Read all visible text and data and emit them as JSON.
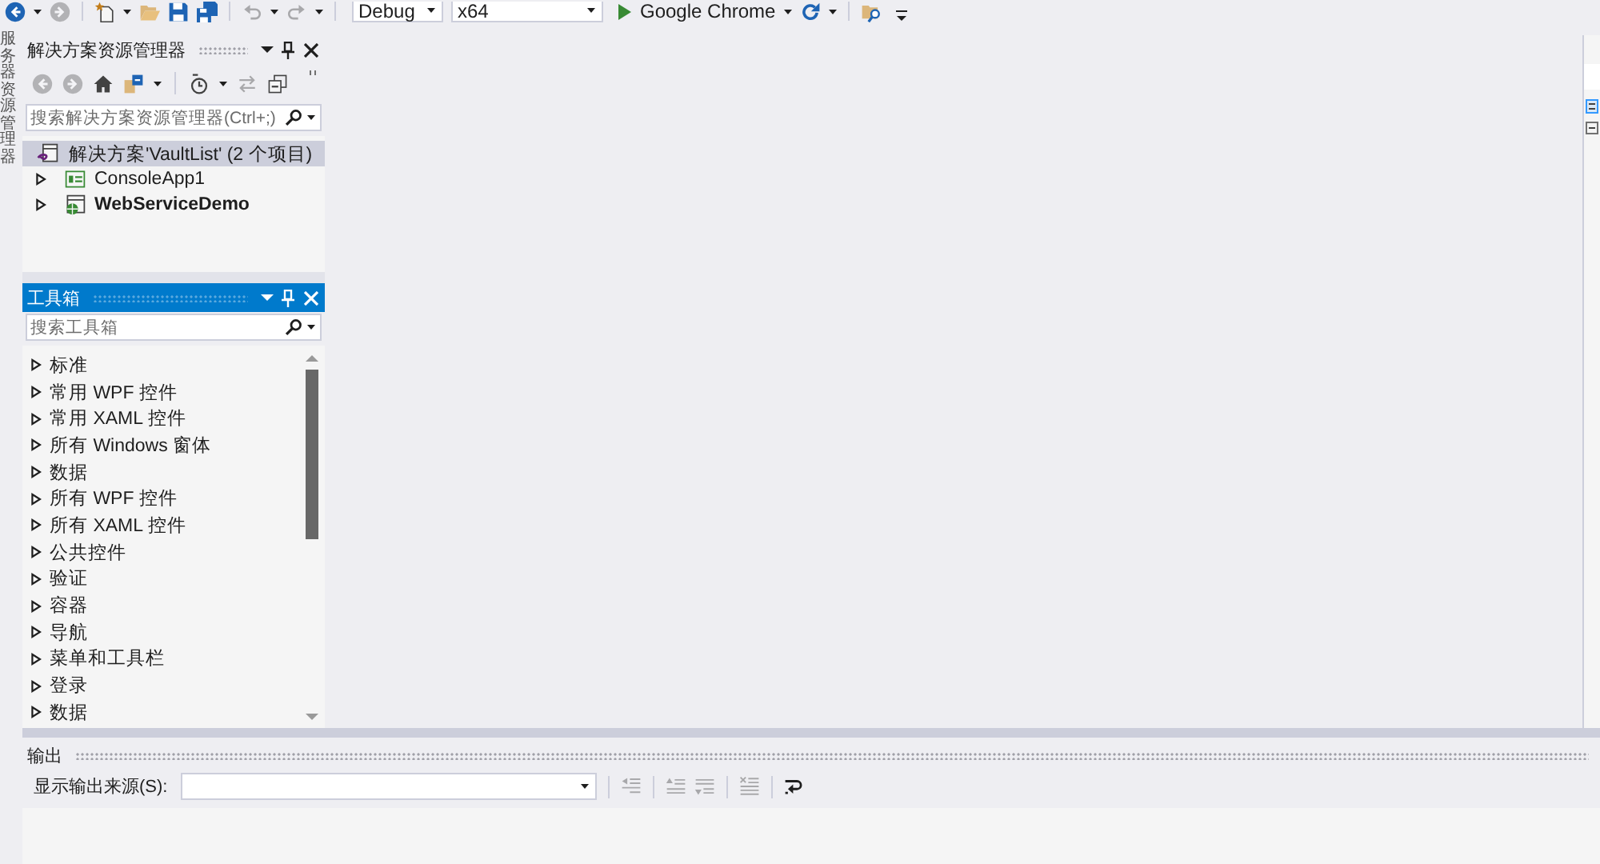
{
  "toolbar": {
    "nav": [
      {
        "kind": "back",
        "disabled": false
      },
      {
        "kind": "forward",
        "disabled": true
      }
    ],
    "file": [
      {
        "kind": "new-project",
        "disabled": false
      },
      {
        "kind": "open",
        "disabled": false
      },
      {
        "kind": "save",
        "disabled": false
      },
      {
        "kind": "save-all",
        "disabled": false
      }
    ],
    "edit": [
      {
        "kind": "undo",
        "disabled": true
      },
      {
        "kind": "redo",
        "disabled": true
      }
    ],
    "configuration": "Debug",
    "platform": "x64",
    "run_target": "Google Chrome",
    "tools": [
      {
        "kind": "refresh",
        "disabled": false
      },
      {
        "kind": "find-in-files",
        "disabled": false
      }
    ]
  },
  "side_tabs": [
    {
      "label": "服务器资源管理器"
    }
  ],
  "solution_explorer": {
    "title": "解决方案资源管理器",
    "active": false,
    "toolbar": [
      {
        "kind": "back",
        "disabled": true
      },
      {
        "kind": "forward",
        "disabled": true
      },
      {
        "kind": "home",
        "disabled": false
      },
      {
        "kind": "sync-active",
        "disabled": false
      },
      {
        "kind": "pending-changes",
        "disabled": false
      },
      {
        "kind": "sync",
        "disabled": true
      },
      {
        "kind": "collapse-all",
        "disabled": false
      }
    ],
    "search": {
      "placeholder": "搜索解决方案资源管理器(Ctrl+;)"
    },
    "tree": [
      {
        "label": "解决方案'VaultList' (2 个项目)",
        "kind": "solution",
        "selected": true,
        "children": [
          {
            "label": "ConsoleApp1",
            "kind": "csharp-project",
            "selected": false,
            "expanded": false,
            "startup": false
          },
          {
            "label": "WebServiceDemo",
            "kind": "web-project",
            "selected": false,
            "expanded": false,
            "startup": true
          }
        ]
      }
    ]
  },
  "toolbox": {
    "title": "工具箱",
    "active": true,
    "search": {
      "placeholder": "搜索工具箱"
    },
    "groups": [
      {
        "label": "标准",
        "expanded": false
      },
      {
        "label": "常用 WPF 控件",
        "expanded": false
      },
      {
        "label": "常用 XAML 控件",
        "expanded": false
      },
      {
        "label": "所有 Windows 窗体",
        "expanded": false
      },
      {
        "label": "数据",
        "expanded": false
      },
      {
        "label": "所有 WPF 控件",
        "expanded": false
      },
      {
        "label": "所有 XAML 控件",
        "expanded": false
      },
      {
        "label": "公共控件",
        "expanded": false
      },
      {
        "label": "验证",
        "expanded": false
      },
      {
        "label": "容器",
        "expanded": false
      },
      {
        "label": "导航",
        "expanded": false
      },
      {
        "label": "菜单和工具栏",
        "expanded": false
      },
      {
        "label": "登录",
        "expanded": false
      },
      {
        "label": "数据",
        "expanded": false
      }
    ]
  },
  "output": {
    "title": "输出",
    "active": false,
    "source_label": "显示输出来源(S):",
    "toolbar": [
      {
        "kind": "go-to-line",
        "disabled": true
      },
      {
        "kind": "previous",
        "disabled": true
      },
      {
        "kind": "next",
        "disabled": true
      },
      {
        "kind": "clear",
        "disabled": true
      },
      {
        "kind": "word-wrap",
        "disabled": false
      }
    ]
  }
}
